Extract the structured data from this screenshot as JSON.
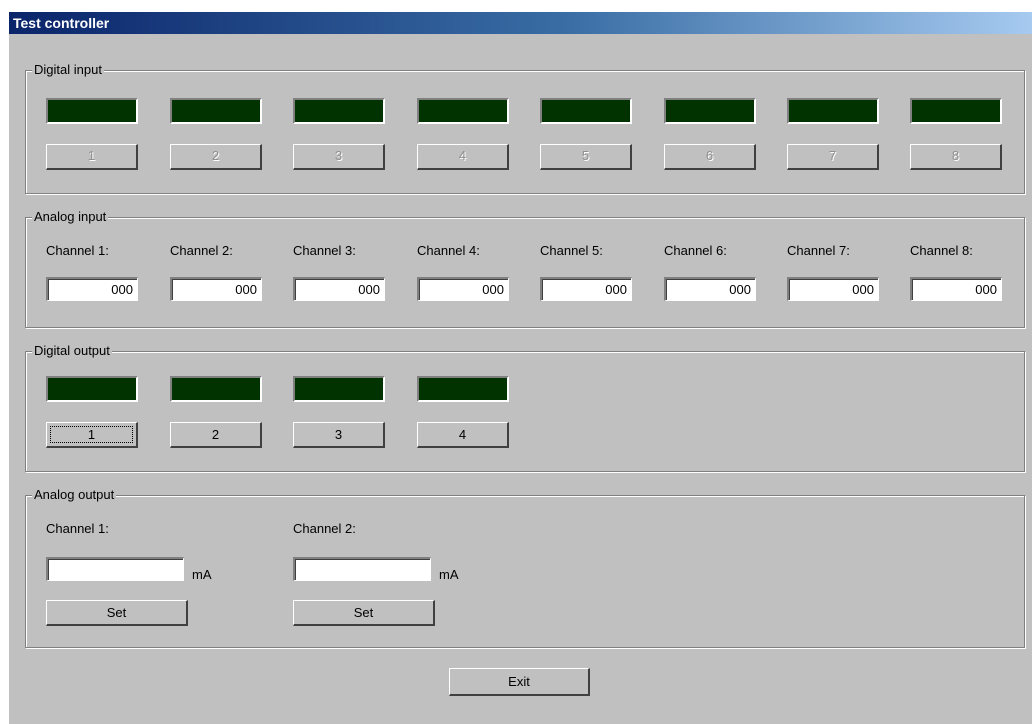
{
  "window": {
    "title": "Test controller"
  },
  "digital_input": {
    "label": "Digital input",
    "leds": [
      "on",
      "on",
      "on",
      "on",
      "on",
      "on",
      "on",
      "on"
    ],
    "buttons": [
      "1",
      "2",
      "3",
      "4",
      "5",
      "6",
      "7",
      "8"
    ]
  },
  "analog_input": {
    "label": "Analog input",
    "channels": [
      {
        "label": "Channel 1:",
        "value": "000"
      },
      {
        "label": "Channel 2:",
        "value": "000"
      },
      {
        "label": "Channel 3:",
        "value": "000"
      },
      {
        "label": "Channel 4:",
        "value": "000"
      },
      {
        "label": "Channel 5:",
        "value": "000"
      },
      {
        "label": "Channel 6:",
        "value": "000"
      },
      {
        "label": "Channel 7:",
        "value": "000"
      },
      {
        "label": "Channel 8:",
        "value": "000"
      }
    ]
  },
  "digital_output": {
    "label": "Digital output",
    "buttons": [
      "1",
      "2",
      "3",
      "4"
    ]
  },
  "analog_output": {
    "label": "Analog output",
    "channels": [
      {
        "label": "Channel 1:",
        "value": "",
        "unit": "mA",
        "set_label": "Set"
      },
      {
        "label": "Channel 2:",
        "value": "",
        "unit": "mA",
        "set_label": "Set"
      }
    ]
  },
  "exit_label": "Exit",
  "colors": {
    "led": "#003300",
    "face": "#c0c0c0",
    "title_start": "#0a246a"
  }
}
